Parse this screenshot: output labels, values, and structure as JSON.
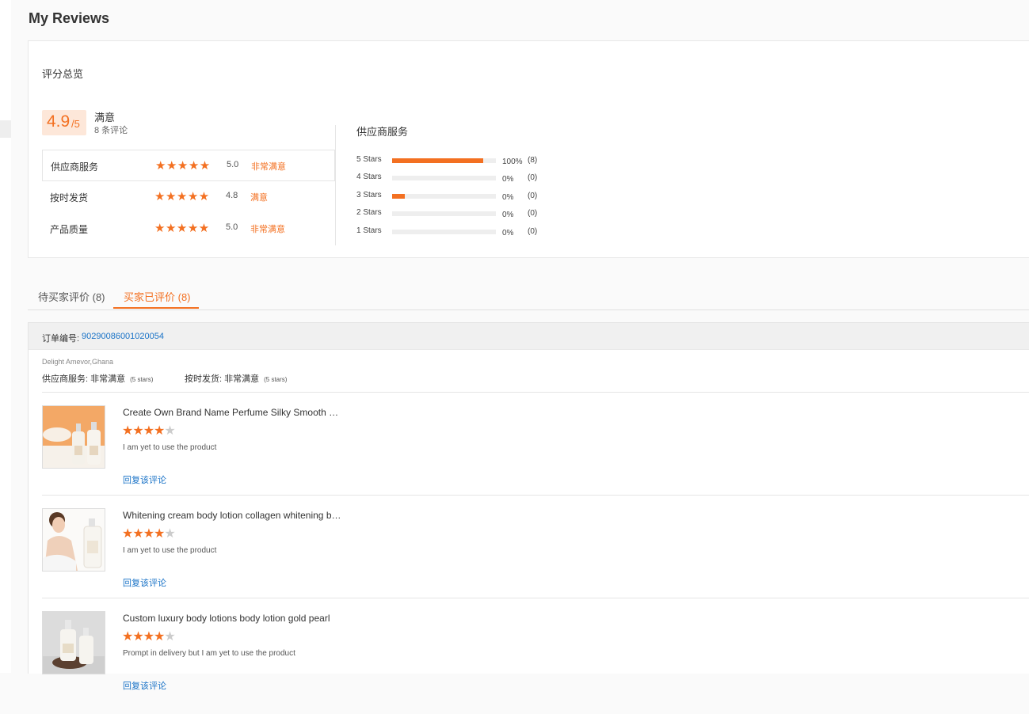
{
  "page": {
    "title": "My Reviews"
  },
  "overview": {
    "title": "评分总览",
    "score": "4.9",
    "score_max": "/5",
    "satisfaction": "满意",
    "review_count": "8 条评论",
    "ratings": [
      {
        "label": "供应商服务",
        "stars": 5,
        "score": "5.0",
        "text": "非常满意"
      },
      {
        "label": "按时发货",
        "stars": 5,
        "score": "4.8",
        "text": "满意"
      },
      {
        "label": "产品质量",
        "stars": 5,
        "score": "5.0",
        "text": "非常满意"
      }
    ],
    "distribution_title": "供应商服务",
    "distribution": [
      {
        "label": "5 Stars",
        "pct": "100%",
        "count": "(8)",
        "fill": 0.88
      },
      {
        "label": "4 Stars",
        "pct": "0%",
        "count": "(0)",
        "fill": 0
      },
      {
        "label": "3 Stars",
        "pct": "0%",
        "count": "(0)",
        "fill": 0.12
      },
      {
        "label": "2 Stars",
        "pct": "0%",
        "count": "(0)",
        "fill": 0
      },
      {
        "label": "1 Stars",
        "pct": "0%",
        "count": "(0)",
        "fill": 0
      }
    ]
  },
  "tabs": [
    {
      "label": "待买家评价 (8)",
      "active": false
    },
    {
      "label": "买家已评价 (8)",
      "active": true
    }
  ],
  "order": {
    "number_label": "订单编号:",
    "number": "90290086001020054",
    "buyer_location": "Delight Amevor,Ghana",
    "buyer_ratings": [
      {
        "label": "供应商服务: 非常满意",
        "stars": "(5 stars)"
      },
      {
        "label": "按时发货: 非常满意",
        "stars": "(5 stars)"
      }
    ],
    "items": [
      {
        "title": "Create Own Brand Name Perfume Silky Smooth Whitening Body Lotion",
        "rating": 4,
        "comment": "I am yet to use the product",
        "reply": "回复该评论",
        "image": "lotion-bottles-orange"
      },
      {
        "title": "Whitening cream body lotion collagen whitening body lotion",
        "rating": 4,
        "comment": "I am yet to use the product",
        "reply": "回复该评论",
        "image": "woman-with-lotion"
      },
      {
        "title": "Custom luxury body lotions body lotion gold pearl",
        "rating": 4,
        "comment": "Prompt in delivery but I am yet to use the product",
        "reply": "回复该评论",
        "image": "lotion-bottles-wood"
      }
    ]
  },
  "colors": {
    "accent": "#f37021",
    "link": "#1a73c7",
    "star_off": "#cccccc",
    "score_bg": "#fde7d9"
  }
}
